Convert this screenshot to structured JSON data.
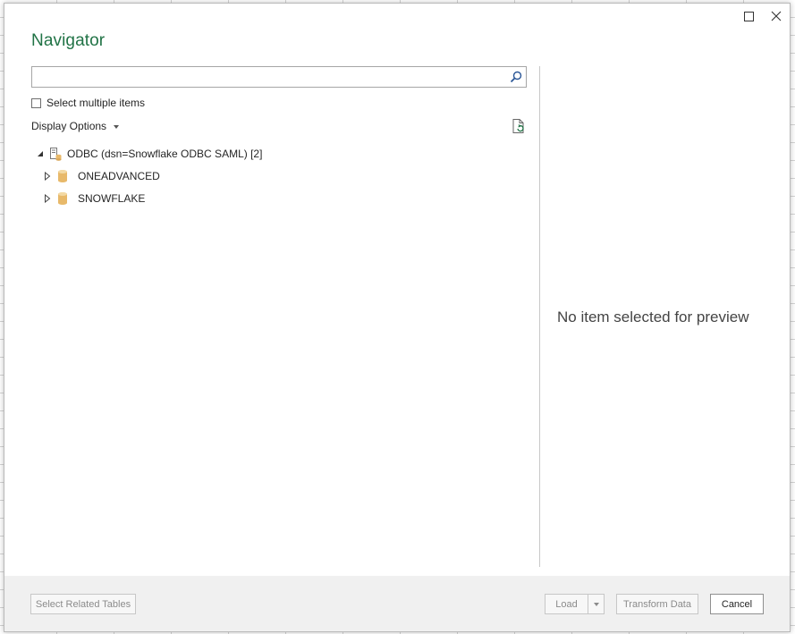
{
  "dialog": {
    "title": "Navigator"
  },
  "search": {
    "value": "",
    "placeholder": ""
  },
  "multi_select": {
    "label": "Select multiple items",
    "checked": false
  },
  "display_options": {
    "label": "Display Options"
  },
  "tree": {
    "root": {
      "label": "ODBC (dsn=Snowflake ODBC SAML) [2]",
      "expanded": true
    },
    "children": [
      {
        "label": "ONEADVANCED",
        "expanded": false
      },
      {
        "label": "SNOWFLAKE",
        "expanded": false
      }
    ]
  },
  "preview": {
    "message": "No item selected for preview"
  },
  "footer": {
    "related_label": "Select Related Tables",
    "load_label": "Load",
    "transform_label": "Transform Data",
    "cancel_label": "Cancel"
  },
  "colors": {
    "title": "#217346",
    "database_icon": "#e8b96a"
  },
  "icons": {
    "search": "search-icon",
    "refresh": "refresh-document-icon",
    "server": "odbc-server-icon",
    "database": "database-icon",
    "maximize": "maximize-icon",
    "close": "close-icon"
  }
}
